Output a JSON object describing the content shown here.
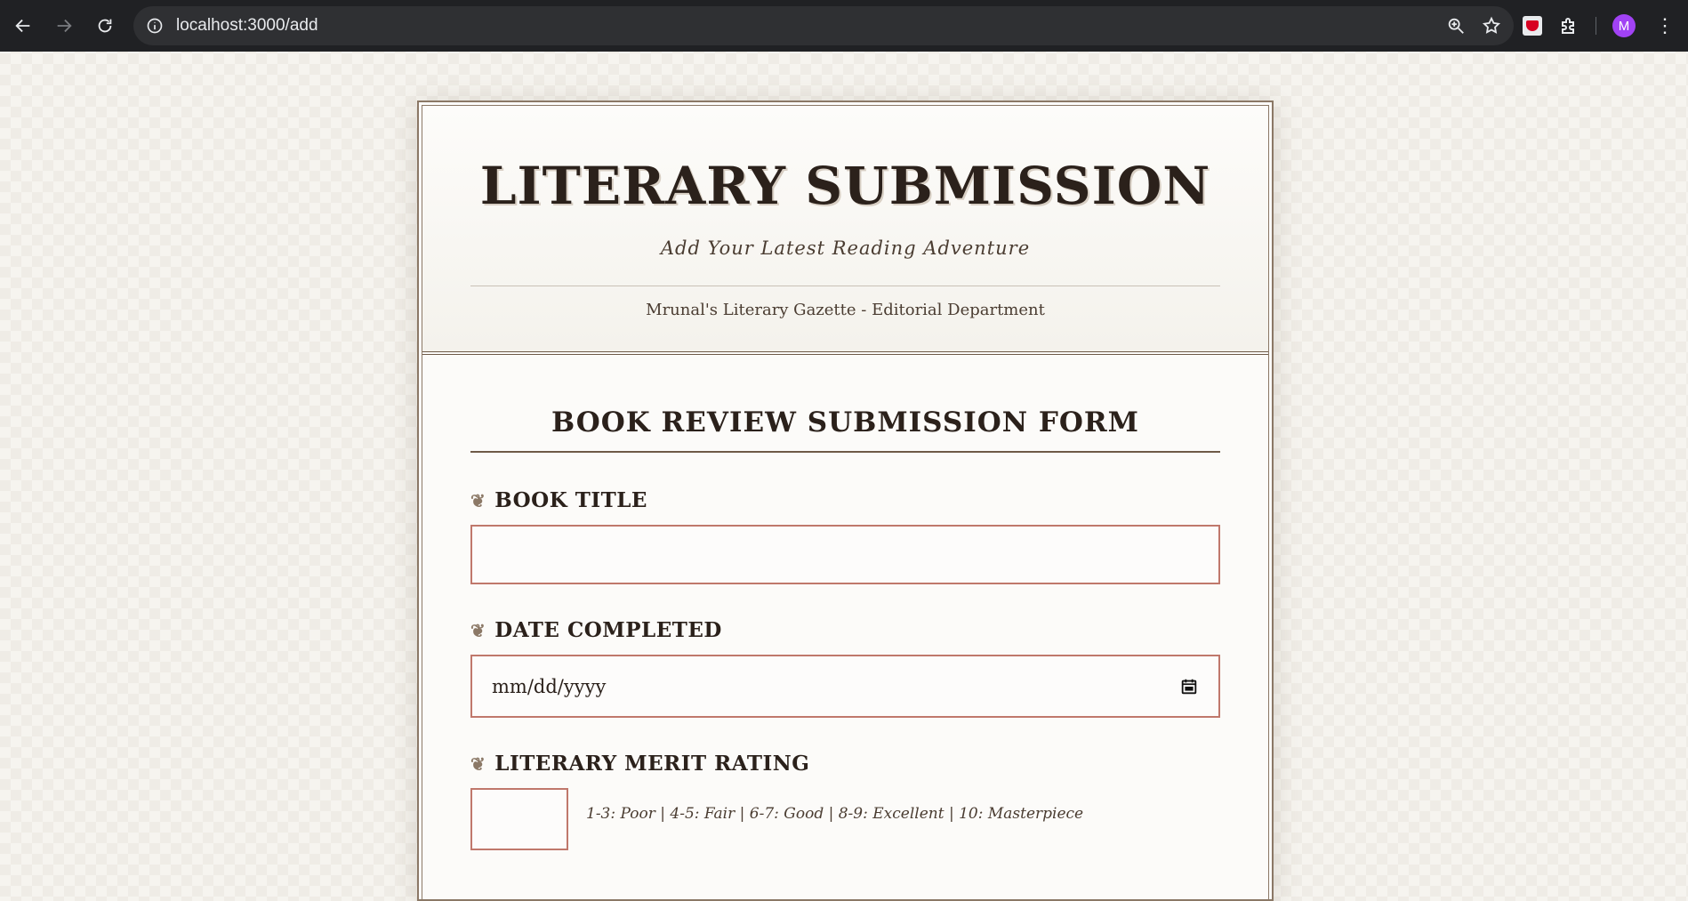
{
  "browser": {
    "url": "localhost:3000/add",
    "avatar_letter": "M"
  },
  "masthead": {
    "title": "LITERARY SUBMISSION",
    "subtitle": "Add Your Latest Reading Adventure",
    "department": "Mrunal's Literary Gazette - Editorial Department"
  },
  "form": {
    "heading": "BOOK REVIEW SUBMISSION FORM",
    "ornament": "❦",
    "fields": {
      "title_label": "BOOK TITLE",
      "title_value": "",
      "date_label": "DATE COMPLETED",
      "date_placeholder": "mm/dd/yyyy",
      "rating_label": "LITERARY MERIT RATING",
      "rating_value": "",
      "rating_hint": "1-3: Poor | 4-5: Fair | 6-7: Good | 8-9: Excellent | 10: Masterpiece"
    }
  }
}
